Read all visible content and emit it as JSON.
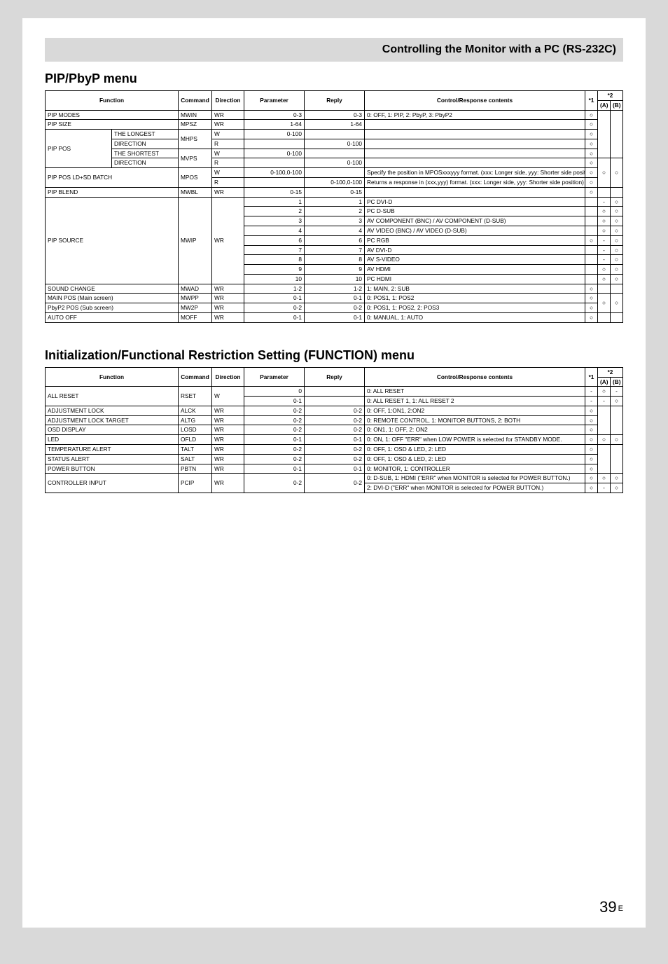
{
  "header_title": "Controlling the Monitor with a PC (RS-232C)",
  "section1_title": "PIP/PbyP menu",
  "section2_title": "Initialization/Functional Restriction Setting (FUNCTION) menu",
  "page_number": "39",
  "page_suffix": "E",
  "headers": {
    "function": "Function",
    "command": "Command",
    "direction": "Direction",
    "parameter": "Parameter",
    "reply": "Reply",
    "content": "Control/Response contents",
    "s1": "*1",
    "s2": "*2",
    "s2a": "(A)",
    "s2b": "(B)"
  },
  "t1": {
    "r0": {
      "f1": "PIP MODES",
      "cmd": "MWIN",
      "dir": "WR",
      "param": "0-3",
      "reply": "0-3",
      "content": "0: OFF, 1: PIP, 2: PbyP, 3: PbyP2",
      "s1": "○",
      "a": "",
      "b": ""
    },
    "r1": {
      "f1": "PIP SIZE",
      "cmd": "MPSZ",
      "dir": "WR",
      "param": "1-64",
      "reply": "1-64",
      "content": "",
      "s1": "○",
      "a": "",
      "b": ""
    },
    "r2a": {
      "f1": "PIP POS",
      "f2": "THE LONGEST",
      "cmd": "MHPS",
      "dir": "W",
      "param": "0-100",
      "reply": "",
      "content": "",
      "s1": "○",
      "a": "",
      "b": ""
    },
    "r2b": {
      "f2": "DIRECTION",
      "dir": "R",
      "param": "",
      "reply": "0-100",
      "content": "",
      "s1": "○",
      "a": "",
      "b": ""
    },
    "r3a": {
      "f2": "THE SHORTEST",
      "cmd": "MVPS",
      "dir": "W",
      "param": "0-100",
      "reply": "",
      "content": "",
      "s1": "○",
      "a": "",
      "b": ""
    },
    "r3b": {
      "f2": "DIRECTION",
      "dir": "R",
      "param": "",
      "reply": "0-100",
      "content": "",
      "s1": "○",
      "a": "○",
      "b": "○"
    },
    "r4a": {
      "f1": "PIP POS LD+SD BATCH",
      "cmd": "MPOS",
      "dir": "W",
      "param": "0-100,0-100",
      "reply": "",
      "content": "Specify the position in MPOSxxxyyy format.\n(xxx: Longer side, yyy: Shorter side position)",
      "s1": "○",
      "a": "",
      "b": ""
    },
    "r4b": {
      "dir": "R",
      "param": "",
      "reply": "0-100,0-100",
      "content": "Returns a response in (xxx,yyy) format.\n(xxx: Longer side, yyy: Shorter side position)",
      "s1": "○",
      "a": "",
      "b": ""
    },
    "r5": {
      "f1": "PIP BLEND",
      "cmd": "MWBL",
      "dir": "WR",
      "param": "0-15",
      "reply": "0-15",
      "content": "",
      "s1": "○",
      "a": "",
      "b": ""
    },
    "r6a": {
      "f1": "PIP SOURCE",
      "cmd": "MWIP",
      "dir": "WR",
      "param": "1",
      "reply": "1",
      "content": "PC DVI-D",
      "s1": "",
      "a": "-",
      "b": "○"
    },
    "r6b": {
      "param": "2",
      "reply": "2",
      "content": "PC D-SUB",
      "s1": "",
      "a": "○",
      "b": "○"
    },
    "r6c": {
      "param": "3",
      "reply": "3",
      "content": "AV COMPONENT (BNC) / AV COMPONENT (D-SUB)",
      "s1": "",
      "a": "○",
      "b": "○"
    },
    "r6d": {
      "param": "4",
      "reply": "4",
      "content": "AV VIDEO (BNC) / AV VIDEO (D-SUB)",
      "s1": "",
      "a": "○",
      "b": "○"
    },
    "r6e": {
      "param": "6",
      "reply": "6",
      "content": "PC RGB",
      "s1": "○",
      "a": "-",
      "b": "○"
    },
    "r6f": {
      "param": "7",
      "reply": "7",
      "content": "AV DVI-D",
      "s1": "",
      "a": "-",
      "b": "○"
    },
    "r6g": {
      "param": "8",
      "reply": "8",
      "content": "AV S-VIDEO",
      "s1": "",
      "a": "-",
      "b": "○"
    },
    "r6h": {
      "param": "9",
      "reply": "9",
      "content": "AV HDMI",
      "s1": "",
      "a": "○",
      "b": "○"
    },
    "r6i": {
      "param": "10",
      "reply": "10",
      "content": "PC HDMI",
      "s1": "",
      "a": "○",
      "b": "○"
    },
    "r7": {
      "f1": "SOUND CHANGE",
      "cmd": "MWAD",
      "dir": "WR",
      "param": "1-2",
      "reply": "1-2",
      "content": "1: MAIN, 2: SUB",
      "s1": "○",
      "a": "",
      "b": ""
    },
    "r8": {
      "f1": "MAIN POS (Main screen)",
      "cmd": "MWPP",
      "dir": "WR",
      "param": "0-1",
      "reply": "0-1",
      "content": "0: POS1, 1: POS2",
      "s1": "○",
      "a": "○",
      "b": "○"
    },
    "r9": {
      "f1": "PbyP2 POS (Sub screen)",
      "cmd": "MW2P",
      "dir": "WR",
      "param": "0-2",
      "reply": "0-2",
      "content": "0: POS1, 1: POS2, 2: POS3",
      "s1": "○",
      "a": "",
      "b": ""
    },
    "r10": {
      "f1": "AUTO OFF",
      "cmd": "MOFF",
      "dir": "WR",
      "param": "0-1",
      "reply": "0-1",
      "content": "0: MANUAL, 1: AUTO",
      "s1": "○",
      "a": "",
      "b": ""
    }
  },
  "t2": {
    "r0a": {
      "f": "ALL RESET",
      "cmd": "RSET",
      "dir": "W",
      "param": "0",
      "reply": "",
      "content": "0: ALL RESET",
      "s1": "-",
      "a": "○",
      "b": "-"
    },
    "r0b": {
      "param": "0-1",
      "reply": "",
      "content": "0: ALL RESET 1, 1: ALL RESET 2",
      "s1": "-",
      "a": "-",
      "b": "○"
    },
    "r1": {
      "f": "ADJUSTMENT LOCK",
      "cmd": "ALCK",
      "dir": "WR",
      "param": "0-2",
      "reply": "0-2",
      "content": "0: OFF, 1:ON1, 2:ON2",
      "s1": "○",
      "a": "",
      "b": ""
    },
    "r2": {
      "f": "ADJUSTMENT LOCK TARGET",
      "cmd": "ALTG",
      "dir": "WR",
      "param": "0-2",
      "reply": "0-2",
      "content": "0: REMOTE CONTROL, 1: MONITOR BUTTONS, 2: BOTH",
      "s1": "○",
      "a": "",
      "b": ""
    },
    "r3": {
      "f": "OSD DISPLAY",
      "cmd": "LOSD",
      "dir": "WR",
      "param": "0-2",
      "reply": "0-2",
      "content": "0: ON1, 1: OFF, 2: ON2",
      "s1": "○",
      "a": "",
      "b": ""
    },
    "r4": {
      "f": "LED",
      "cmd": "OFLD",
      "dir": "WR",
      "param": "0-1",
      "reply": "0-1",
      "content": "0: ON, 1: OFF\n\"ERR\" when LOW POWER is selected for STANDBY MODE.",
      "s1": "○",
      "a": "○",
      "b": "○"
    },
    "r5": {
      "f": "TEMPERATURE ALERT",
      "cmd": "TALT",
      "dir": "WR",
      "param": "0-2",
      "reply": "0-2",
      "content": "0: OFF, 1: OSD & LED, 2: LED",
      "s1": "○",
      "a": "",
      "b": ""
    },
    "r6": {
      "f": "STATUS ALERT",
      "cmd": "SALT",
      "dir": "WR",
      "param": "0-2",
      "reply": "0-2",
      "content": "0: OFF, 1: OSD & LED, 2: LED",
      "s1": "○",
      "a": "",
      "b": ""
    },
    "r7": {
      "f": "POWER BUTTON",
      "cmd": "PBTN",
      "dir": "WR",
      "param": "0-1",
      "reply": "0-1",
      "content": "0: MONITOR, 1: CONTROLLER",
      "s1": "○",
      "a": "",
      "b": ""
    },
    "r8a": {
      "f": "CONTROLLER INPUT",
      "cmd": "PCIP",
      "dir": "WR",
      "param": "0-2",
      "reply": "0-2",
      "content": "0: D-SUB, 1: HDMI (\"ERR\" when MONITOR is selected for POWER BUTTON.)",
      "s1": "○",
      "a": "○",
      "b": "○"
    },
    "r8b": {
      "content": "2: DVI-D (\"ERR\" when MONITOR is selected for POWER BUTTON.)",
      "s1": "○",
      "a": "-",
      "b": "○"
    }
  }
}
